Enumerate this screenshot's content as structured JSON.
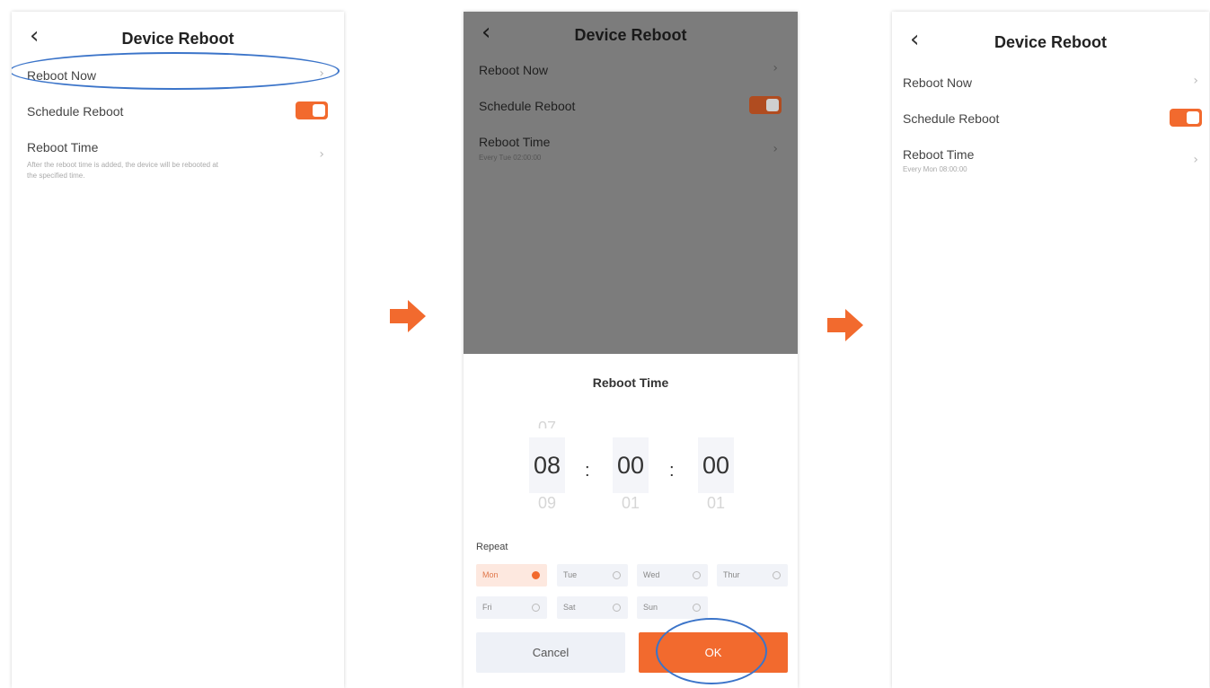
{
  "colors": {
    "accent": "#f26a2e",
    "annotation": "#3b74c9",
    "overlay": "#5f5f5f"
  },
  "screen1": {
    "title": "Device Reboot",
    "reboot_now": "Reboot Now",
    "schedule_reboot": "Schedule Reboot",
    "schedule_enabled": true,
    "reboot_time": "Reboot Time",
    "reboot_time_desc_line1": "After the reboot time is added, the device will be rebooted at",
    "reboot_time_desc_line2": "the specified time."
  },
  "screen2": {
    "title": "Device Reboot",
    "reboot_now": "Reboot Now",
    "schedule_reboot": "Schedule Reboot",
    "schedule_enabled": true,
    "reboot_time": "Reboot Time",
    "reboot_time_value": "Every Tue 02:00:00",
    "sheet": {
      "title": "Reboot Time",
      "hour": {
        "prev": "07",
        "current": "08",
        "next": "09"
      },
      "minute": {
        "prev": "",
        "current": "00",
        "next": "01"
      },
      "second": {
        "prev": "",
        "current": "00",
        "next": "01"
      },
      "separator": ":",
      "repeat_label": "Repeat",
      "days": [
        {
          "label": "Mon",
          "selected": true
        },
        {
          "label": "Tue",
          "selected": false
        },
        {
          "label": "Wed",
          "selected": false
        },
        {
          "label": "Thur",
          "selected": false
        },
        {
          "label": "Fri",
          "selected": false
        },
        {
          "label": "Sat",
          "selected": false
        },
        {
          "label": "Sun",
          "selected": false
        }
      ],
      "cancel_label": "Cancel",
      "ok_label": "OK"
    }
  },
  "screen3": {
    "title": "Device Reboot",
    "reboot_now": "Reboot Now",
    "schedule_reboot": "Schedule Reboot",
    "schedule_enabled": true,
    "reboot_time": "Reboot Time",
    "reboot_time_value": "Every Mon 08:00:00"
  },
  "icons": {
    "back": "chevron-left-icon",
    "forward": "chevron-right-icon",
    "flow_arrow": "arrow-right-icon"
  }
}
